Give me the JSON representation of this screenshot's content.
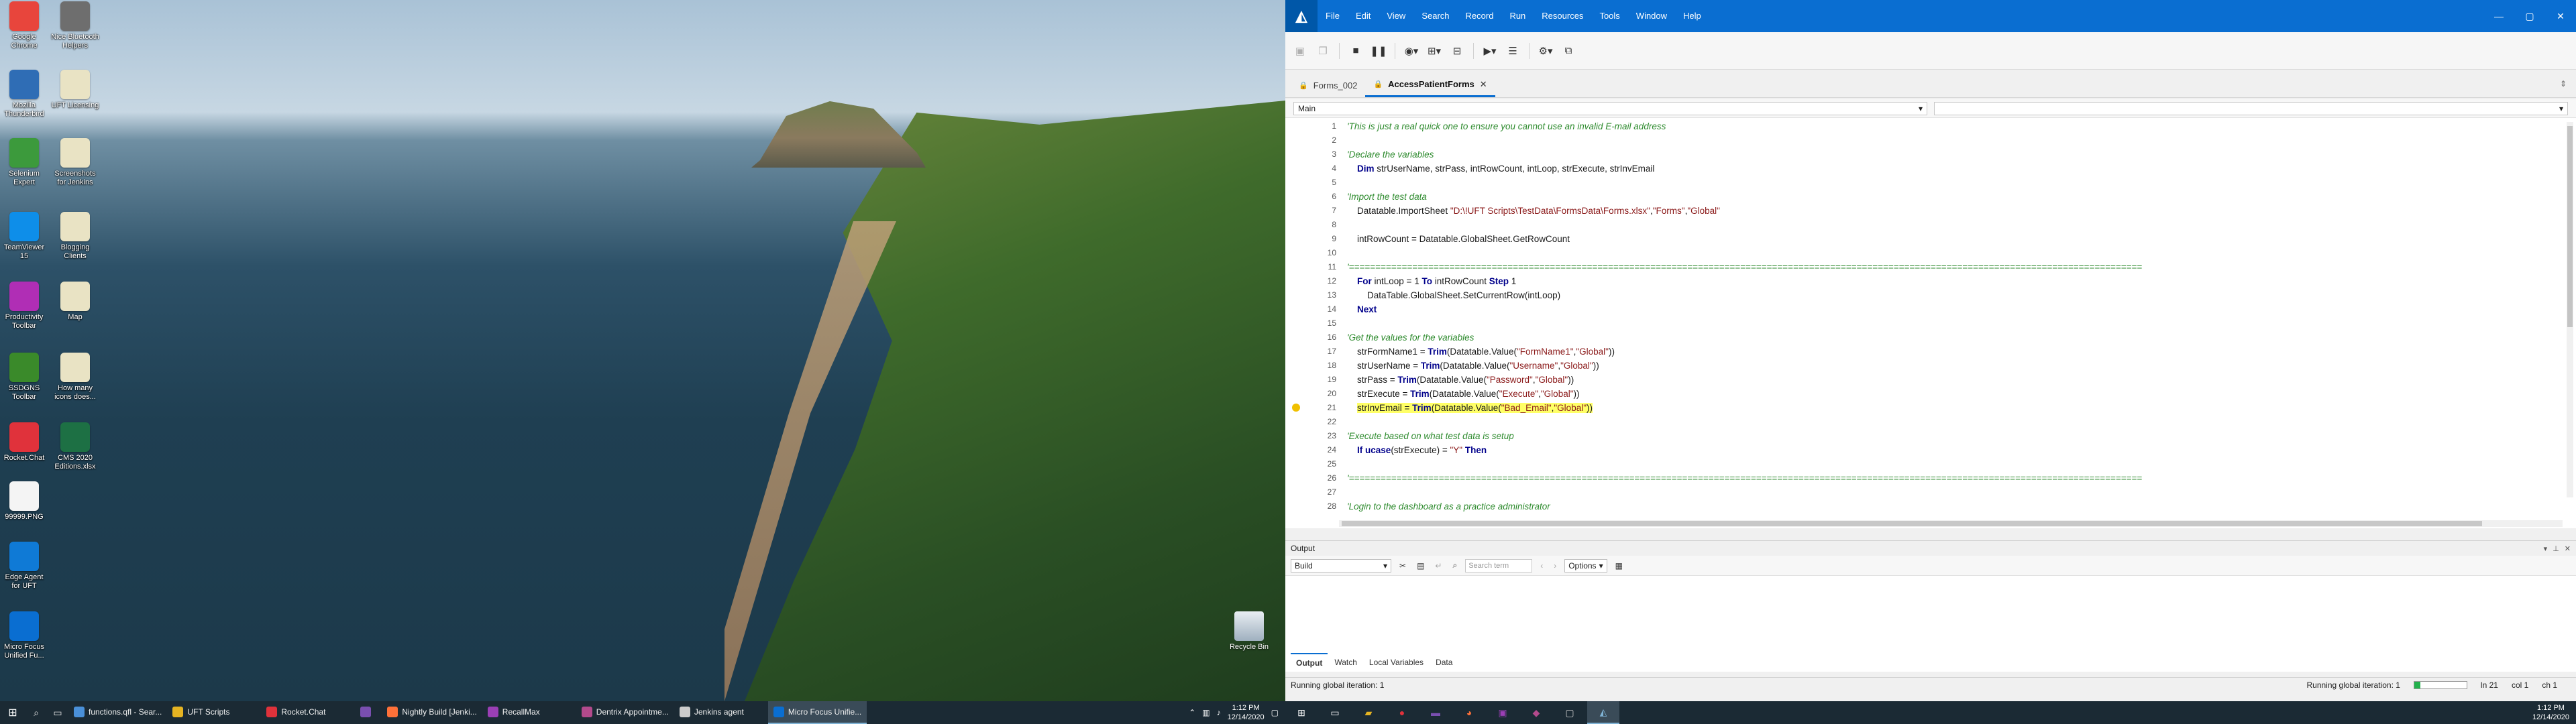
{
  "desktop": {
    "icons": [
      {
        "label": "Google Chrome",
        "icon": "chrome-icon",
        "color": "#e8453c"
      },
      {
        "label": "Nice Bluetooth Helpers",
        "icon": "app-icon",
        "color": "#6e6e6e"
      },
      {
        "label": "Mozilla Thunderbird",
        "icon": "thunderbird-icon",
        "color": "#2f6db5"
      },
      {
        "label": "UFT Licensing",
        "icon": "document-icon",
        "color": "#e9e3c4"
      },
      {
        "label": "Selenium Expert",
        "icon": "selenium-icon",
        "color": "#3c9a3c"
      },
      {
        "label": "Screenshots for Jenkins",
        "icon": "document-icon",
        "color": "#e9e3c4"
      },
      {
        "label": "TeamViewer 15",
        "icon": "teamviewer-icon",
        "color": "#0e8ee9"
      },
      {
        "label": "Blogging Clients",
        "icon": "document-icon",
        "color": "#e9e3c4"
      },
      {
        "label": "Productivity Toolbar",
        "icon": "toolbar-icon",
        "color": "#b02eb5"
      },
      {
        "label": "Map",
        "icon": "document-icon",
        "color": "#e9e3c4"
      },
      {
        "label": "SSDGNS Toolbar",
        "icon": "tree-icon",
        "color": "#3a8a2a"
      },
      {
        "label": "How many icons does...",
        "icon": "document-icon",
        "color": "#e9e3c4"
      },
      {
        "label": "Rocket.Chat",
        "icon": "rocketchat-icon",
        "color": "#e0323b"
      },
      {
        "label": "CMS 2020 Editions.xlsx",
        "icon": "excel-icon",
        "color": "#1d7044"
      },
      {
        "label": "99999.PNG",
        "icon": "image-file-icon",
        "color": "#f4f4f4"
      },
      {
        "label": "Edge Agent for UFT",
        "icon": "edge-icon",
        "color": "#0f7ad6"
      },
      {
        "label": "Micro Focus Unified Fu...",
        "icon": "uft-icon",
        "color": "#0a6ed1"
      }
    ],
    "recycle_bin": "Recycle Bin"
  },
  "taskbar_left": {
    "apps": [
      {
        "label": "functions.qfl - Sear...",
        "color": "#4a90d9",
        "active": false
      },
      {
        "label": "UFT Scripts",
        "color": "#e6b422",
        "active": false
      },
      {
        "label": "Rocket.Chat",
        "color": "#e0323b",
        "active": false
      },
      {
        "label": "",
        "color": "#7a4fb0",
        "active": false
      },
      {
        "label": "Nightly Build [Jenki...",
        "color": "#ff7139",
        "active": false
      },
      {
        "label": "RecallMax",
        "color": "#9b3fb5",
        "active": false
      },
      {
        "label": "Dentrix Appointme...",
        "color": "#b34a8c",
        "active": false
      },
      {
        "label": "Jenkins agent",
        "color": "#cccccc",
        "active": false
      },
      {
        "label": "Micro Focus Unifie...",
        "color": "#0a6ed1",
        "active": true
      }
    ],
    "time": "1:12 PM",
    "date": "12/14/2020"
  },
  "uft": {
    "menus": [
      "File",
      "Edit",
      "View",
      "Search",
      "Record",
      "Run",
      "Resources",
      "Tools",
      "Window",
      "Help"
    ],
    "tabs": [
      {
        "label": "Forms_002",
        "active": false
      },
      {
        "label": "AccessPatientForms",
        "active": true
      }
    ],
    "scope_selector": "Main",
    "member_selector": "",
    "code_lines": [
      {
        "n": "1",
        "parts": [
          {
            "c": "comment",
            "t": "'This is just a real quick one to ensure you cannot use an invalid E-mail address"
          }
        ]
      },
      {
        "n": "2",
        "parts": []
      },
      {
        "n": "3",
        "parts": [
          {
            "c": "comment",
            "t": "'Declare the variables"
          }
        ]
      },
      {
        "n": "4",
        "parts": [
          {
            "c": "plain",
            "t": "    "
          },
          {
            "c": "kw",
            "t": "Dim"
          },
          {
            "c": "plain",
            "t": " strUserName, strPass, intRowCount, intLoop, strExecute, strInvEmail"
          }
        ]
      },
      {
        "n": "5",
        "parts": []
      },
      {
        "n": "6",
        "parts": [
          {
            "c": "comment",
            "t": "'Import the test data"
          }
        ]
      },
      {
        "n": "7",
        "parts": [
          {
            "c": "plain",
            "t": "    Datatable.ImportSheet "
          },
          {
            "c": "str",
            "t": "\"D:\\!UFT Scripts\\TestData\\FormsData\\Forms.xlsx\""
          },
          {
            "c": "plain",
            "t": ","
          },
          {
            "c": "str",
            "t": "\"Forms\""
          },
          {
            "c": "plain",
            "t": ","
          },
          {
            "c": "str",
            "t": "\"Global\""
          }
        ]
      },
      {
        "n": "8",
        "parts": []
      },
      {
        "n": "9",
        "parts": [
          {
            "c": "plain",
            "t": "    intRowCount = Datatable.GlobalSheet.GetRowCount"
          }
        ]
      },
      {
        "n": "10",
        "parts": []
      },
      {
        "n": "11",
        "parts": [
          {
            "c": "comment",
            "t": "'======================================================================================================================================================"
          }
        ]
      },
      {
        "n": "12",
        "parts": [
          {
            "c": "plain",
            "t": "    "
          },
          {
            "c": "kw",
            "t": "For"
          },
          {
            "c": "plain",
            "t": " intLoop = 1 "
          },
          {
            "c": "kw",
            "t": "To"
          },
          {
            "c": "plain",
            "t": " intRowCount "
          },
          {
            "c": "kw",
            "t": "Step"
          },
          {
            "c": "plain",
            "t": " 1"
          }
        ]
      },
      {
        "n": "13",
        "parts": [
          {
            "c": "plain",
            "t": "        DataTable.GlobalSheet.SetCurrentRow(intLoop)"
          }
        ]
      },
      {
        "n": "14",
        "parts": [
          {
            "c": "plain",
            "t": "    "
          },
          {
            "c": "kw",
            "t": "Next"
          }
        ]
      },
      {
        "n": "15",
        "parts": []
      },
      {
        "n": "16",
        "parts": [
          {
            "c": "comment",
            "t": "'Get the values for the variables"
          }
        ]
      },
      {
        "n": "17",
        "parts": [
          {
            "c": "plain",
            "t": "    strFormName1 = "
          },
          {
            "c": "kw",
            "t": "Trim"
          },
          {
            "c": "plain",
            "t": "(Datatable.Value("
          },
          {
            "c": "str",
            "t": "\"FormName1\""
          },
          {
            "c": "plain",
            "t": ","
          },
          {
            "c": "str",
            "t": "\"Global\""
          },
          {
            "c": "plain",
            "t": "))"
          }
        ]
      },
      {
        "n": "18",
        "parts": [
          {
            "c": "plain",
            "t": "    strUserName = "
          },
          {
            "c": "kw",
            "t": "Trim"
          },
          {
            "c": "plain",
            "t": "(Datatable.Value("
          },
          {
            "c": "str",
            "t": "\"Username\""
          },
          {
            "c": "plain",
            "t": ","
          },
          {
            "c": "str",
            "t": "\"Global\""
          },
          {
            "c": "plain",
            "t": "))"
          }
        ]
      },
      {
        "n": "19",
        "parts": [
          {
            "c": "plain",
            "t": "    strPass = "
          },
          {
            "c": "kw",
            "t": "Trim"
          },
          {
            "c": "plain",
            "t": "(Datatable.Value("
          },
          {
            "c": "str",
            "t": "\"Password\""
          },
          {
            "c": "plain",
            "t": ","
          },
          {
            "c": "str",
            "t": "\"Global\""
          },
          {
            "c": "plain",
            "t": "))"
          }
        ]
      },
      {
        "n": "20",
        "parts": [
          {
            "c": "plain",
            "t": "    strExecute = "
          },
          {
            "c": "kw",
            "t": "Trim"
          },
          {
            "c": "plain",
            "t": "(Datatable.Value("
          },
          {
            "c": "str",
            "t": "\"Execute\""
          },
          {
            "c": "plain",
            "t": ","
          },
          {
            "c": "str",
            "t": "\"Global\""
          },
          {
            "c": "plain",
            "t": "))"
          }
        ]
      },
      {
        "n": "21",
        "highlight": true,
        "parts": [
          {
            "c": "plain",
            "t": "    "
          },
          {
            "c": "plain hl",
            "t": "strInvEmail = "
          },
          {
            "c": "kw hl",
            "t": "Trim"
          },
          {
            "c": "plain hl",
            "t": "(Datatable.Value("
          },
          {
            "c": "str hl",
            "t": "\"Bad_Email\""
          },
          {
            "c": "plain hl",
            "t": ","
          },
          {
            "c": "str hl",
            "t": "\"Global\""
          },
          {
            "c": "plain hl",
            "t": "))"
          }
        ]
      },
      {
        "n": "22",
        "parts": []
      },
      {
        "n": "23",
        "parts": [
          {
            "c": "comment",
            "t": "'Execute based on what test data is setup"
          }
        ]
      },
      {
        "n": "24",
        "parts": [
          {
            "c": "plain",
            "t": "    "
          },
          {
            "c": "kw",
            "t": "If"
          },
          {
            "c": "plain",
            "t": " "
          },
          {
            "c": "kw",
            "t": "ucase"
          },
          {
            "c": "plain",
            "t": "(strExecute) = "
          },
          {
            "c": "str",
            "t": "\"Y\""
          },
          {
            "c": "plain",
            "t": " "
          },
          {
            "c": "kw",
            "t": "Then"
          }
        ]
      },
      {
        "n": "25",
        "parts": []
      },
      {
        "n": "26",
        "parts": [
          {
            "c": "comment",
            "t": "'======================================================================================================================================================"
          }
        ]
      },
      {
        "n": "27",
        "parts": []
      },
      {
        "n": "28",
        "parts": [
          {
            "c": "comment",
            "t": "'Login to the dashboard as a practice administrator"
          }
        ]
      }
    ],
    "output": {
      "title": "Output",
      "source": "Build",
      "search_placeholder": "Search term",
      "options_label": "Options",
      "tabs": [
        {
          "label": "Output",
          "active": true
        },
        {
          "label": "Watch",
          "active": false
        },
        {
          "label": "Local Variables",
          "active": false
        },
        {
          "label": "Data",
          "active": false
        }
      ]
    },
    "status": {
      "left": "Running global iteration: 1",
      "right": "Running global iteration: 1",
      "progress": 0.12,
      "line": "ln 21",
      "col": "col 1",
      "ch": "ch 1"
    }
  },
  "taskbar_right": {
    "time": "1:12 PM",
    "date": "12/14/2020"
  }
}
